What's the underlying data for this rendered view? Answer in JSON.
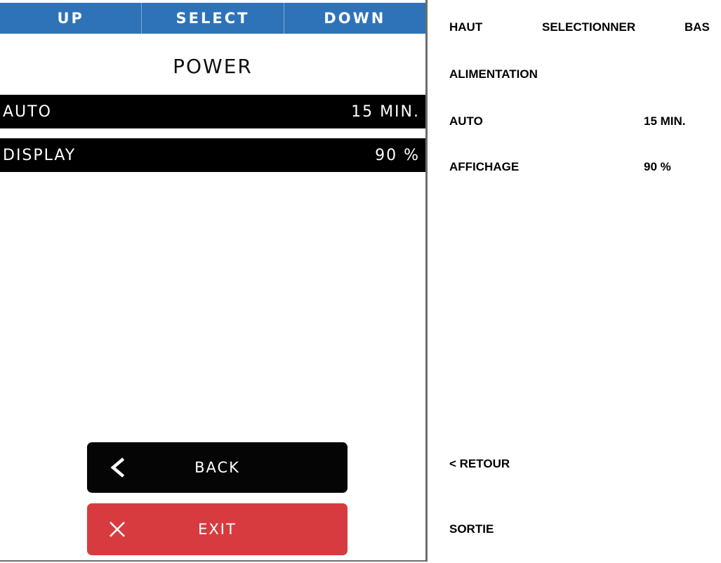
{
  "device": {
    "nav": {
      "up": "UP",
      "select": "SELECT",
      "down": "DOWN"
    },
    "title": "POWER",
    "settings": [
      {
        "label": "AUTO",
        "value": "15 MIN."
      },
      {
        "label": "DISPLAY",
        "value": "90 %"
      }
    ],
    "back_label": "BACK",
    "exit_label": "EXIT"
  },
  "translation": {
    "nav": {
      "up": "HAUT",
      "select": "SELECTIONNER",
      "down": "BAS"
    },
    "title": "ALIMENTATION",
    "settings": [
      {
        "label": "AUTO",
        "value": "15 MIN."
      },
      {
        "label": "AFFICHAGE",
        "value": "90 %"
      }
    ],
    "back_label": "< RETOUR",
    "exit_label": "SORTIE"
  },
  "colors": {
    "nav_bar": "#2e73b8",
    "setting_row": "#000000",
    "back_button": "#050505",
    "exit_button": "#d83b3f"
  },
  "icons": {
    "back": "chevron-left-icon",
    "exit": "close-icon"
  }
}
